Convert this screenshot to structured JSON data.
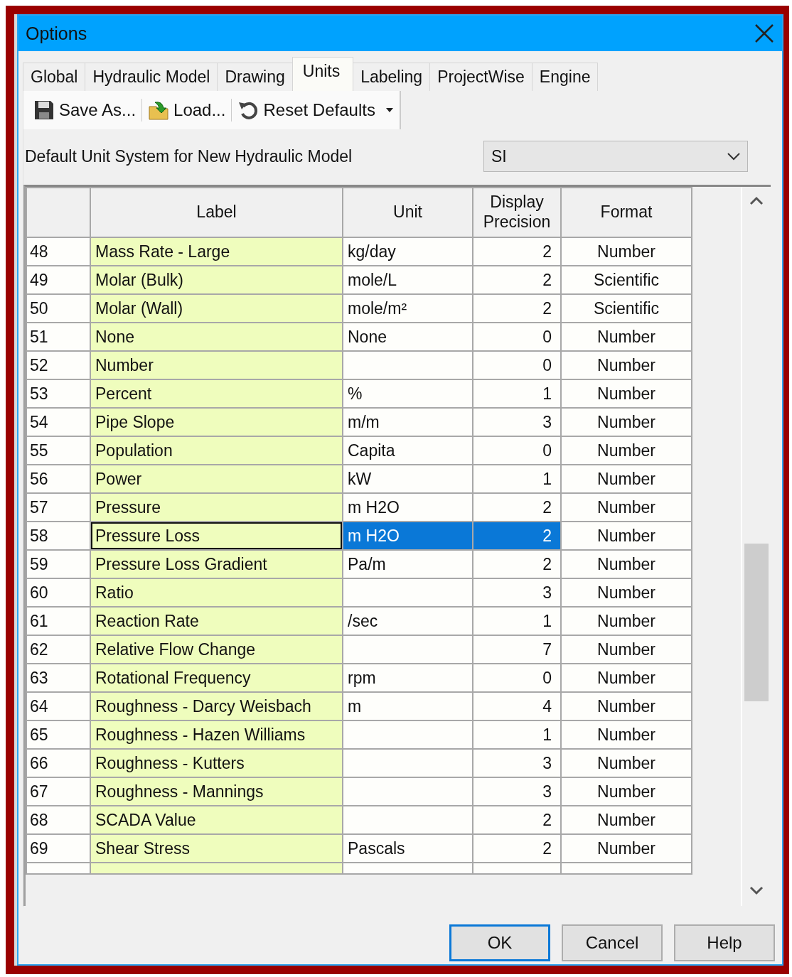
{
  "window": {
    "title": "Options"
  },
  "tabs": [
    {
      "label": "Global",
      "selected": false
    },
    {
      "label": "Hydraulic Model",
      "selected": false
    },
    {
      "label": "Drawing",
      "selected": false
    },
    {
      "label": "Units",
      "selected": true
    },
    {
      "label": "Labeling",
      "selected": false
    },
    {
      "label": "ProjectWise",
      "selected": false
    },
    {
      "label": "Engine",
      "selected": false
    }
  ],
  "toolbar": [
    {
      "label": "Save As...",
      "kind": "save"
    },
    {
      "label": "Load...",
      "kind": "load"
    },
    {
      "label": "Reset Defaults",
      "kind": "reset"
    }
  ],
  "unit_system": {
    "label": "Default Unit System for New Hydraulic Model",
    "value": "SI"
  },
  "table": {
    "columns": [
      "Label",
      "Unit",
      "Display Precision",
      "Format"
    ],
    "rows": [
      {
        "number": "48",
        "label": "Mass Rate - Large",
        "unit": "kg/day",
        "precision": "2",
        "format": "Number",
        "selected": false
      },
      {
        "number": "49",
        "label": "Molar (Bulk)",
        "unit": "mole/L",
        "precision": "2",
        "format": "Scientific",
        "selected": false
      },
      {
        "number": "50",
        "label": "Molar (Wall)",
        "unit": "mole/m²",
        "precision": "2",
        "format": "Scientific",
        "selected": false
      },
      {
        "number": "51",
        "label": "None",
        "unit": "None",
        "precision": "0",
        "format": "Number",
        "selected": false
      },
      {
        "number": "52",
        "label": "Number",
        "precision": "0",
        "format": "Number",
        "selected": false
      },
      {
        "number": "53",
        "label": "Percent",
        "unit": "%",
        "precision": "1",
        "format": "Number",
        "selected": false
      },
      {
        "number": "54",
        "label": "Pipe Slope",
        "unit": "m/m",
        "precision": "3",
        "format": "Number",
        "selected": false
      },
      {
        "number": "55",
        "label": "Population",
        "unit": "Capita",
        "precision": "0",
        "format": "Number",
        "selected": false
      },
      {
        "number": "56",
        "label": "Power",
        "unit": "kW",
        "precision": "1",
        "format": "Number",
        "selected": false
      },
      {
        "number": "57",
        "label": "Pressure",
        "unit": "m H2O",
        "precision": "2",
        "format": "Number",
        "selected": false
      },
      {
        "number": "58",
        "label": "Pressure Loss",
        "unit": "m H2O",
        "precision": "2",
        "format": "Number",
        "selected": true
      },
      {
        "number": "59",
        "label": "Pressure Loss Gradient",
        "unit": "Pa/m",
        "precision": "2",
        "format": "Number",
        "selected": false
      },
      {
        "number": "60",
        "label": "Ratio",
        "precision": "3",
        "format": "Number",
        "selected": false
      },
      {
        "number": "61",
        "label": "Reaction Rate",
        "unit": "/sec",
        "precision": "1",
        "format": "Number",
        "selected": false
      },
      {
        "number": "62",
        "label": "Relative Flow Change",
        "precision": "7",
        "format": "Number",
        "selected": false
      },
      {
        "number": "63",
        "label": "Rotational Frequency",
        "unit": "rpm",
        "precision": "0",
        "format": "Number",
        "selected": false
      },
      {
        "number": "64",
        "label": "Roughness - Darcy Weisbach",
        "unit": "m",
        "precision": "4",
        "format": "Number",
        "selected": false
      },
      {
        "number": "65",
        "label": "Roughness - Hazen Williams",
        "precision": "1",
        "format": "Number",
        "selected": false
      },
      {
        "number": "66",
        "label": "Roughness - Kutters",
        "precision": "3",
        "format": "Number",
        "selected": false
      },
      {
        "number": "67",
        "label": "Roughness - Mannings",
        "precision": "3",
        "format": "Number",
        "selected": false
      },
      {
        "number": "68",
        "label": "SCADA Value",
        "precision": "2",
        "format": "Number",
        "selected": false
      },
      {
        "number": "69",
        "label": "Shear Stress",
        "unit": "Pascals",
        "precision": "2",
        "format": "Number",
        "selected": false
      }
    ]
  },
  "buttons": [
    {
      "label": "OK",
      "default": true
    },
    {
      "label": "Cancel",
      "default": false
    },
    {
      "label": "Help",
      "default": false
    }
  ]
}
